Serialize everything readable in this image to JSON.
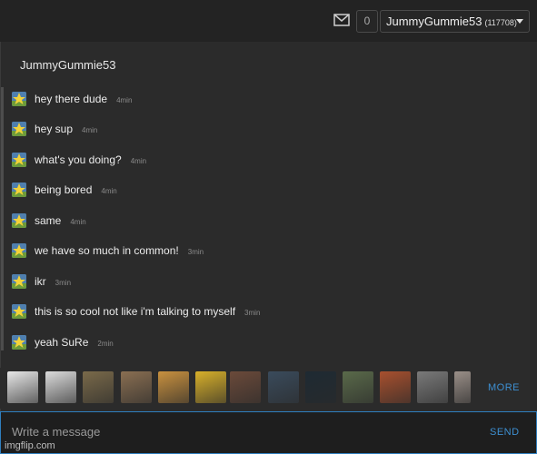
{
  "header": {
    "mail_icon": "envelope-icon",
    "notification_count": "0",
    "username": "JummyGummie53",
    "points": "(117708)"
  },
  "conversation": {
    "title": "JummyGummie53",
    "messages": [
      {
        "text": "hey there dude",
        "time": "4min"
      },
      {
        "text": "hey sup",
        "time": "4min"
      },
      {
        "text": "what's you doing?",
        "time": "4min"
      },
      {
        "text": "being bored",
        "time": "4min"
      },
      {
        "text": "same",
        "time": "4min"
      },
      {
        "text": "we have so much in common!",
        "time": "3min"
      },
      {
        "text": "ikr",
        "time": "3min"
      },
      {
        "text": "this is so cool not like i'm talking to myself",
        "time": "3min"
      },
      {
        "text": "yeah SuRe",
        "time": "2min"
      }
    ]
  },
  "meme_strip": {
    "more_label": "MORE"
  },
  "compose": {
    "placeholder": "Write a message",
    "send_label": "SEND"
  },
  "watermark": "imgflip.com",
  "colors": {
    "accent": "#3d8fd1",
    "background": "#2b2b2b"
  }
}
